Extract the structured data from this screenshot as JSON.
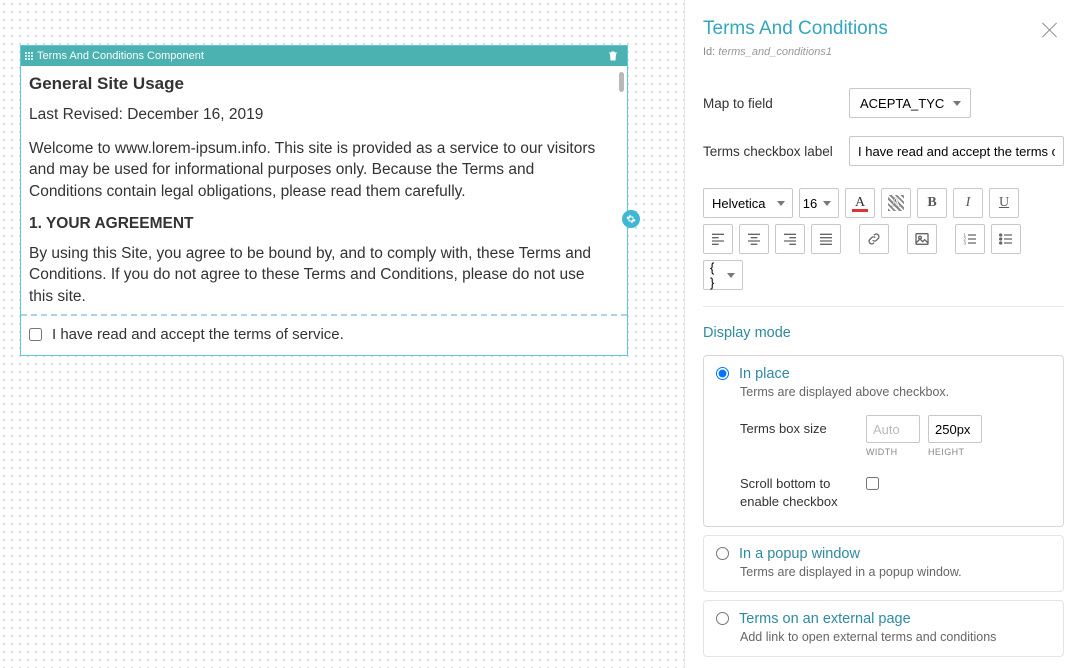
{
  "canvas": {
    "component_header": "Terms And Conditions Component",
    "terms": {
      "title": "General Site Usage",
      "revised": "Last Revised: December 16, 2019",
      "intro": "Welcome to www.lorem-ipsum.info. This site is provided as a service to our visitors and may be used for informational purposes only. Because the Terms and Conditions contain legal obligations, please read them carefully.",
      "section1_heading": "1. YOUR AGREEMENT",
      "section1_body": "By using this Site, you agree to be bound by, and to comply with, these Terms and Conditions. If you do not agree to these Terms and Conditions, please do not use this site."
    },
    "checkbox_label": "I have read and accept the terms of service."
  },
  "panel": {
    "title": "Terms And Conditions",
    "id_label": "Id:",
    "id_value": "terms_and_conditions1",
    "map_to_field_label": "Map to field",
    "map_to_field_value": "ACEPTA_TYC",
    "checkbox_label_label": "Terms checkbox label",
    "checkbox_label_value": "I have read and accept the terms of service",
    "toolbar": {
      "font": "Helvetica",
      "size": "16",
      "code_brace": "{ }"
    },
    "display_mode_title": "Display mode",
    "modes": {
      "inplace": {
        "label": "In place",
        "desc": "Terms are displayed above checkbox."
      },
      "popup": {
        "label": "In a popup window",
        "desc": "Terms are displayed in a popup window."
      },
      "external": {
        "label": "Terms on an external page",
        "desc": "Add link to open external terms and conditions"
      }
    },
    "terms_box_size_label": "Terms box size",
    "width_placeholder": "Auto",
    "width_caption": "WIDTH",
    "height_value": "250px",
    "height_caption": "HEIGHT",
    "scroll_bottom_label": "Scroll bottom to enable checkbox"
  }
}
